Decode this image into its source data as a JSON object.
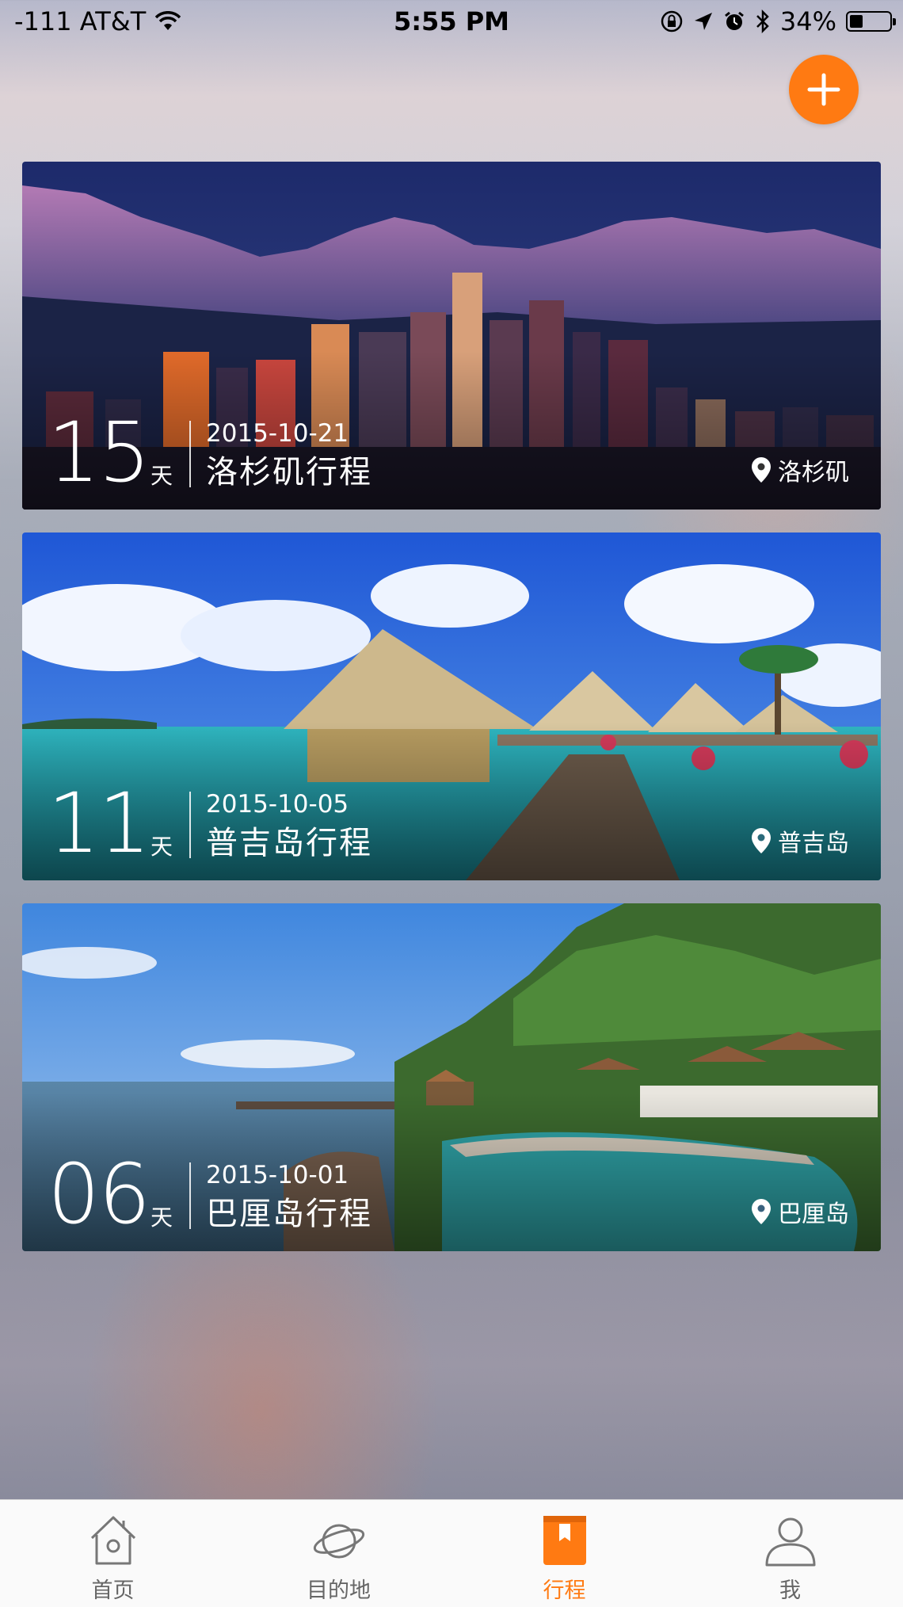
{
  "status_bar": {
    "carrier": "-111 AT&T",
    "time": "5:55 PM",
    "battery": "34%",
    "battery_level": 0.34,
    "icons": [
      "wifi-icon",
      "rotation-lock-icon",
      "location-arrow-icon",
      "alarm-icon",
      "bluetooth-icon",
      "battery-icon"
    ]
  },
  "accent_color": "#ff7a12",
  "add_button": {
    "icon": "plus-icon"
  },
  "trips": [
    {
      "days": "15",
      "days_unit": "天",
      "date": "2015-10-21",
      "name": "洛杉矶行程",
      "location": "洛杉矶"
    },
    {
      "days": "11",
      "days_unit": "天",
      "date": "2015-10-05",
      "name": "普吉岛行程",
      "location": "普吉岛"
    },
    {
      "days": "06",
      "days_unit": "天",
      "date": "2015-10-01",
      "name": "巴厘岛行程",
      "location": "巴厘岛"
    }
  ],
  "tab_bar": {
    "active_index": 2,
    "items": [
      {
        "label": "首页",
        "icon": "home-icon"
      },
      {
        "label": "目的地",
        "icon": "planet-icon"
      },
      {
        "label": "行程",
        "icon": "itinerary-book-icon"
      },
      {
        "label": "我",
        "icon": "profile-icon"
      }
    ]
  }
}
